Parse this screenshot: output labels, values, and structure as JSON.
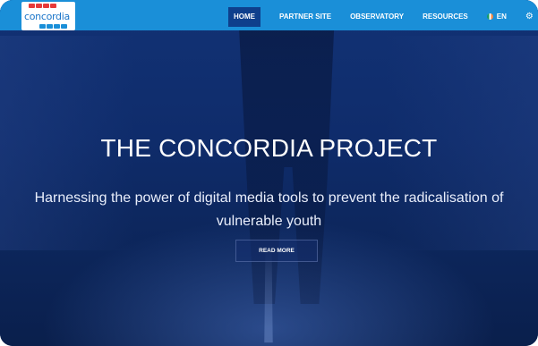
{
  "brand": {
    "logo_text": "concordia",
    "logo_colors": [
      "#e63a3a",
      "#e63a3a",
      "#e63a3a",
      "#e63a3a",
      "#1a8fd8",
      "#1a8fd8",
      "#1a8fd8",
      "#1a8fd8"
    ]
  },
  "nav": {
    "items": [
      {
        "label": "HOME",
        "active": true
      },
      {
        "label": "PARTNER SITE",
        "active": false
      },
      {
        "label": "OBSERVATORY",
        "active": false
      },
      {
        "label": "RESOURCES",
        "active": false
      }
    ],
    "language": {
      "label": "EN",
      "icon": "ireland-flag-icon"
    },
    "settings_icon": "gear-icon"
  },
  "hero": {
    "title": "THE CONCORDIA PROJECT",
    "subtitle": "Harnessing the power of digital media tools to prevent the radicalisation of vulnerable youth",
    "cta_label": "READ MORE"
  },
  "colors": {
    "nav_bar": "#1a8fd8",
    "nav_active": "#0e3f8c",
    "hero_overlay": "#0f2c6b"
  }
}
